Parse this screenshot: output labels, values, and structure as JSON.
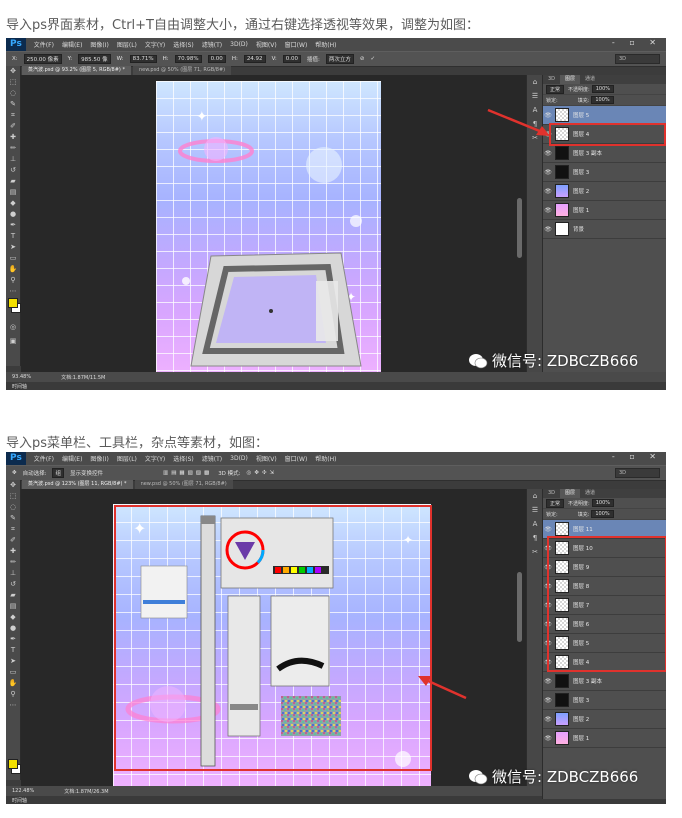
{
  "captions": {
    "first": "导入ps界面素材，Ctrl+T自由调整大小，通过右键选择透视等效果，调整为如图：",
    "second": "导入ps菜单栏、工具栏，杂点等素材，如图："
  },
  "watermark": {
    "text": "微信号: ZDBCZB666",
    "icon": "wechat-icon"
  },
  "ps": {
    "logo": "Ps",
    "menu": [
      "文件(F)",
      "编辑(E)",
      "图像(I)",
      "图层(L)",
      "文字(Y)",
      "选择(S)",
      "滤镜(T)",
      "3D(D)",
      "视图(V)",
      "窗口(W)",
      "帮助(H)"
    ],
    "window_controls": "- ▫ ✕"
  },
  "screenshot1": {
    "options": {
      "x_label": "X:",
      "x_value": "250.00 像素",
      "y_label": "Y:",
      "y_value": "985.50 像",
      "w_label": "W:",
      "w_value": "83.71%",
      "h_label": "H:",
      "h_value": "70.98%",
      "angle_value": "0.00",
      "hskew_label": "H:",
      "hskew_value": "24.92",
      "vskew_label": "V:",
      "vskew_value": "0.00",
      "interp_label": "插值:",
      "interp_value": "两次立方",
      "workspace": "3D"
    },
    "tabs": [
      "蒸汽波.psd @ 93.2% (图层 5, RGB/8#) *",
      "new.psd @ 50% (图层 71, RGB/8#)"
    ],
    "status": {
      "zoom": "93.48%",
      "doc": "文档:1.87M/11.5M",
      "timeline": "时间轴"
    },
    "layers_panel": {
      "tabs": [
        "3D",
        "图层",
        "通道"
      ],
      "blend_mode": "正常",
      "opacity_label": "不透明度:",
      "opacity_value": "100%",
      "lock_label": "锁定:",
      "fill_label": "填充:",
      "fill_value": "100%",
      "layers": [
        {
          "name": "图层 5",
          "thumb": "checker",
          "selected": true
        },
        {
          "name": "图层 4",
          "thumb": "checker",
          "selected": false
        },
        {
          "name": "图层 3 副本",
          "thumb": "black",
          "selected": false
        },
        {
          "name": "图层 3",
          "thumb": "black",
          "selected": false
        },
        {
          "name": "图层 2",
          "thumb": "blue",
          "selected": false
        },
        {
          "name": "图层 1",
          "thumb": "pink",
          "selected": false
        },
        {
          "name": "背景",
          "thumb": "white",
          "selected": false
        }
      ]
    }
  },
  "screenshot2": {
    "options": {
      "auto_select_label": "自动选择:",
      "auto_select_value": "组",
      "show_transform": "显示变换控件",
      "mode_3d": "3D 模式:",
      "workspace": "3D"
    },
    "tabs": [
      "蒸汽波.psd @ 123% (图层 11, RGB/8#) *",
      "new.psd @ 50% (图层 71, RGB/8#)"
    ],
    "status": {
      "zoom": "122.48%",
      "doc": "文档:1.87M/26.3M",
      "timeline": "时间轴"
    },
    "layers_panel": {
      "tabs": [
        "3D",
        "图层",
        "通道"
      ],
      "blend_mode": "正常",
      "opacity_label": "不透明度:",
      "opacity_value": "100%",
      "lock_label": "锁定:",
      "fill_label": "填充:",
      "fill_value": "100%",
      "layers": [
        {
          "name": "图层 11",
          "thumb": "checker",
          "selected": true
        },
        {
          "name": "图层 10",
          "thumb": "checker",
          "selected": false
        },
        {
          "name": "图层 9",
          "thumb": "checker",
          "selected": false
        },
        {
          "name": "图层 8",
          "thumb": "checker",
          "selected": false
        },
        {
          "name": "图层 7",
          "thumb": "checker",
          "selected": false
        },
        {
          "name": "图层 6",
          "thumb": "checker",
          "selected": false
        },
        {
          "name": "图层 5",
          "thumb": "checker",
          "selected": false
        },
        {
          "name": "图层 4",
          "thumb": "checker",
          "selected": false
        },
        {
          "name": "图层 3 副本",
          "thumb": "black",
          "selected": false
        },
        {
          "name": "图层 3",
          "thumb": "black",
          "selected": false
        },
        {
          "name": "图层 2",
          "thumb": "blue",
          "selected": false
        },
        {
          "name": "图层 1",
          "thumb": "pink",
          "selected": false
        }
      ]
    }
  },
  "colors": {
    "highlight_red": "#e0322d",
    "ps_dark": "#3c3c3c",
    "selected_layer": "#6a86b6",
    "foreground_swatch": "#f3e000"
  }
}
